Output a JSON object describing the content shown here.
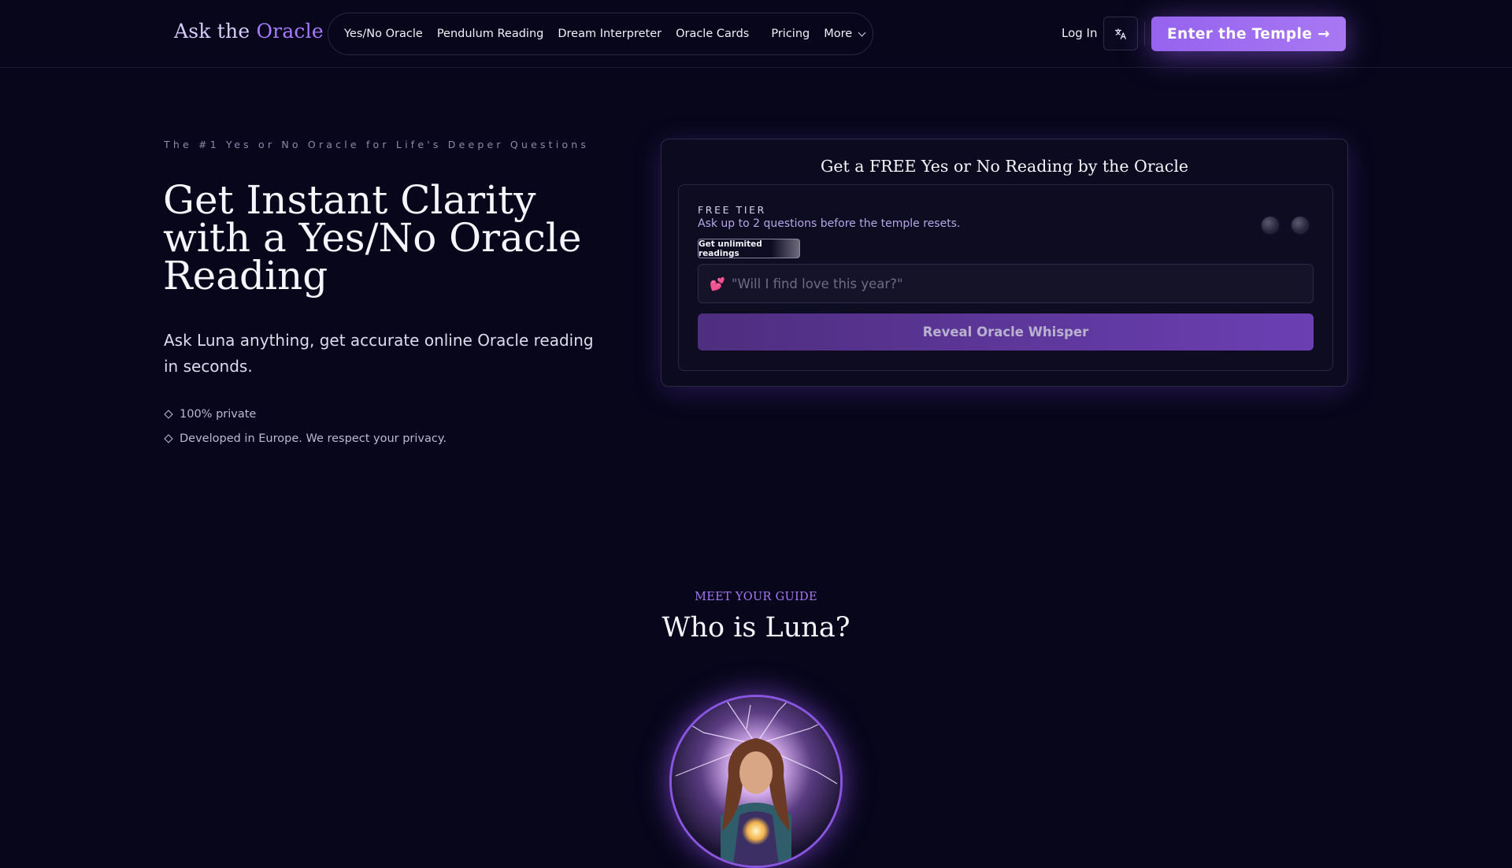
{
  "header": {
    "logo": {
      "part1": "Ask the ",
      "part2": "Oracle"
    },
    "nav": [
      "Yes/No Oracle",
      "Pendulum Reading",
      "Dream Interpreter",
      "Oracle Cards"
    ],
    "pricing": "Pricing",
    "more": "More",
    "login": "Log In",
    "cta": "Enter the Temple →"
  },
  "hero": {
    "eyebrow": "The #1 Yes or No Oracle for Life's Deeper Questions",
    "title": "Get Instant Clarity with a Yes/No Oracle Reading",
    "subtitle": "Ask Luna anything, get accurate online Oracle reading in seconds.",
    "features": [
      "100% private",
      "Developed in Europe. We respect your privacy."
    ]
  },
  "reading_card": {
    "title": "Get a FREE Yes or No Reading by the Oracle",
    "tier_label": "FREE TIER",
    "tier_desc": "Ask up to 2 questions before the temple resets.",
    "unlimited_button": "Get unlimited readings",
    "question_placeholder": "\"Will I find love this year?\"",
    "reveal_button": "Reveal Oracle Whisper"
  },
  "guide": {
    "eyebrow": "MEET YOUR GUIDE",
    "title": "Who is Luna?"
  }
}
